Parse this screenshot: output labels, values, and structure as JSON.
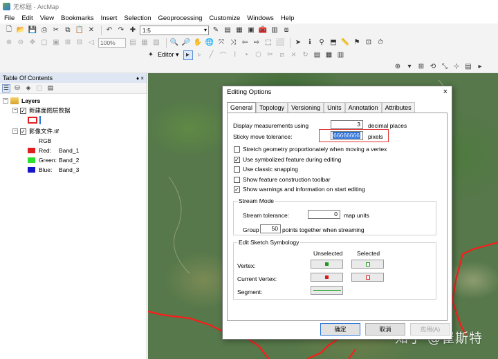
{
  "window": {
    "title": "无标题 - ArcMap"
  },
  "menu": [
    "File",
    "Edit",
    "View",
    "Bookmarks",
    "Insert",
    "Selection",
    "Geoprocessing",
    "Customize",
    "Windows",
    "Help"
  ],
  "toolbar": {
    "scale_value": "1:5",
    "zoom_value": "100%",
    "editor_label": "Editor ▾"
  },
  "toc": {
    "title": "Table Of Contents",
    "pin_close": "♦ ×",
    "root": "Layers",
    "layer1": "新建面图层数据",
    "layer2": "影像文件.tif",
    "rgb_label": "RGB",
    "bands": [
      {
        "label": "Red:",
        "band": "Band_1",
        "color": "#e02020"
      },
      {
        "label": "Green:",
        "band": "Band_2",
        "color": "#2ee02e"
      },
      {
        "label": "Blue:",
        "band": "Band_3",
        "color": "#1414c8"
      }
    ]
  },
  "dialog": {
    "title": "Editing Options",
    "close": "×",
    "tabs": [
      "General",
      "Topology",
      "Versioning",
      "Units",
      "Annotation",
      "Attributes"
    ],
    "display_label": "Display measurements using",
    "display_value": "3",
    "display_suffix": "decimal places",
    "sticky_label": "Sticky move tolerance:",
    "sticky_value": "66666666",
    "sticky_suffix": "pixels",
    "options": [
      {
        "label": "Stretch geometry proportionately when moving a vertex",
        "checked": ""
      },
      {
        "label": "Use symbolized feature during editing",
        "checked": "✓"
      },
      {
        "label": "Use classic snapping",
        "checked": ""
      },
      {
        "label": "Show feature construction toolbar",
        "checked": ""
      },
      {
        "label": "Show warnings and information on start editing",
        "checked": "✓"
      }
    ],
    "stream": {
      "title": "Stream Mode",
      "tolerance_label": "Stream tolerance:",
      "tolerance_value": "0",
      "tolerance_suffix": "map units",
      "group_label": "Group",
      "group_value": "50",
      "group_suffix": "points together when streaming"
    },
    "sketch": {
      "title": "Edit Sketch Symbology",
      "unselected": "Unselected",
      "selected": "Selected",
      "vertex": "Vertex:",
      "current_vertex": "Current Vertex:",
      "segment": "Segment:"
    },
    "buttons": {
      "ok": "确定",
      "cancel": "取消",
      "apply": "应用(A)"
    }
  },
  "watermark": "知乎 @崔斯特"
}
